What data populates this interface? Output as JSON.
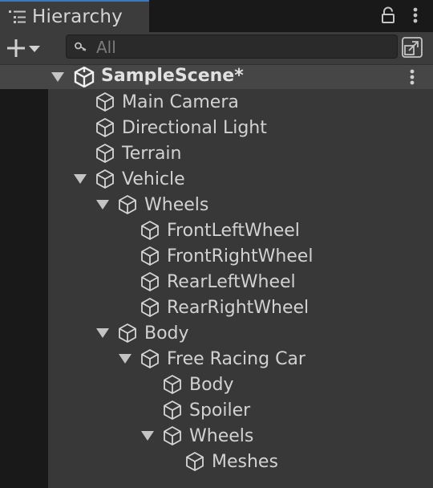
{
  "window": {
    "tab_title": "Hierarchy",
    "tab_icon": "list-icon",
    "actions": [
      "lock-icon",
      "more-vertical-icon"
    ]
  },
  "toolbar": {
    "add_icon": "plus-icon",
    "dropdown_icon": "caret-down-icon",
    "search": {
      "placeholder": "All",
      "value": "",
      "icon": "search-icon"
    },
    "maximize_icon": "maximize-icon"
  },
  "scene": {
    "name": "SampleScene*",
    "icon": "unity-logo-icon",
    "expanded": true
  },
  "items": [
    {
      "label": "Main Camera",
      "depth": 1,
      "expandable": false,
      "icon": "cube-icon"
    },
    {
      "label": "Directional Light",
      "depth": 1,
      "expandable": false,
      "icon": "cube-icon"
    },
    {
      "label": "Terrain",
      "depth": 1,
      "expandable": false,
      "icon": "cube-icon"
    },
    {
      "label": "Vehicle",
      "depth": 1,
      "expandable": true,
      "icon": "cube-icon"
    },
    {
      "label": "Wheels",
      "depth": 2,
      "expandable": true,
      "icon": "cube-icon"
    },
    {
      "label": "FrontLeftWheel",
      "depth": 3,
      "expandable": false,
      "icon": "cube-icon"
    },
    {
      "label": "FrontRightWheel",
      "depth": 3,
      "expandable": false,
      "icon": "cube-icon"
    },
    {
      "label": "RearLeftWheel",
      "depth": 3,
      "expandable": false,
      "icon": "cube-icon"
    },
    {
      "label": "RearRightWheel",
      "depth": 3,
      "expandable": false,
      "icon": "cube-icon"
    },
    {
      "label": "Body",
      "depth": 2,
      "expandable": true,
      "icon": "cube-icon"
    },
    {
      "label": "Free Racing Car",
      "depth": 3,
      "expandable": true,
      "icon": "cube-icon"
    },
    {
      "label": "Body",
      "depth": 4,
      "expandable": false,
      "icon": "cube-icon"
    },
    {
      "label": "Spoiler",
      "depth": 4,
      "expandable": false,
      "icon": "cube-icon"
    },
    {
      "label": "Wheels",
      "depth": 4,
      "expandable": true,
      "icon": "cube-icon"
    },
    {
      "label": "Meshes",
      "depth": 5,
      "expandable": false,
      "icon": "cube-icon"
    }
  ],
  "colors": {
    "panel": "#383838",
    "tab_accent": "#3a79bb",
    "text": "#d2d2d2"
  }
}
